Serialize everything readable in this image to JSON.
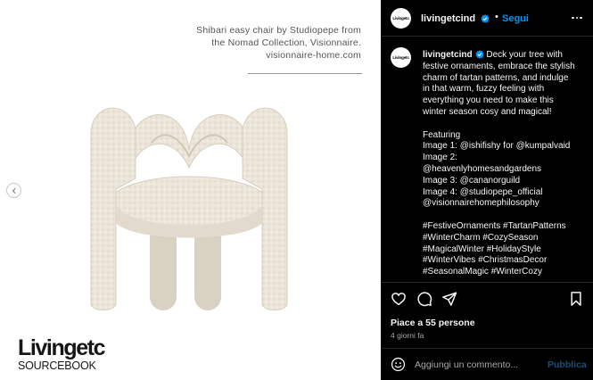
{
  "image": {
    "caption_lines": [
      "Shibari easy chair by Studiopepe from",
      "the Nomad Collection, Visionnaire.",
      "visionnaire-home.com"
    ],
    "logo": {
      "main": "Livingetc",
      "sub": "SOURCEBOOK"
    },
    "prev_arrow_icon": "chevron-left-icon"
  },
  "post": {
    "username": "livingetcind",
    "avatar_text": "Livingetc",
    "separator": "•",
    "follow_label": "Segui",
    "caption": {
      "username": "livingetcind",
      "lines": [
        " Deck your tree with",
        "festive ornaments, embrace the stylish",
        "charm of tartan patterns, and indulge",
        "in that warm, fuzzy feeling with",
        "everything you need to make this",
        "winter season cosy and magical!",
        "",
        "Featuring",
        "Image 1: @ishifishy for @kumpalvaid",
        "Image 2:",
        "@heavenlyhomesandgardens",
        "Image 3: @cananorguild",
        "Image 4: @studiopepe_official",
        "@visionnairehomephilosophy",
        "",
        "#FestiveOrnaments #TartanPatterns",
        "#WinterCharm #CozySeason",
        "#MagicalWinter #HolidayStyle",
        "#WinterVibes #ChristmasDecor",
        "#SeasonalMagic #WinterCozy"
      ]
    },
    "likes_text": "Piace a 55 persone",
    "time_ago": "4 giorni fa",
    "comment_placeholder": "Aggiungi un commento...",
    "publish_label": "Pubblica"
  },
  "colors": {
    "follow_blue": "#0095f6",
    "publish_blue_disabled": "#1b4f7a",
    "panel_bg": "#000000",
    "chair_boucle": "#ece6da"
  },
  "icons": [
    "more-icon",
    "heart-icon",
    "comment-icon",
    "share-icon",
    "bookmark-icon",
    "emoji-icon",
    "verified-badge-icon"
  ]
}
